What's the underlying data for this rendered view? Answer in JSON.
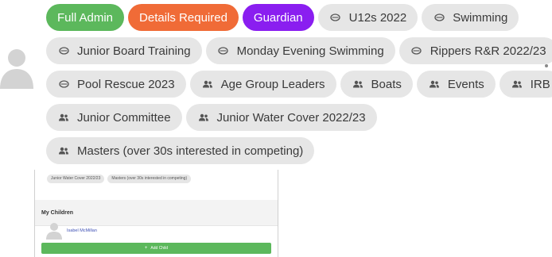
{
  "profile": {
    "avatar_icon": "user-silhouette-icon",
    "menu_icon": "kebab-menu-icon"
  },
  "tags": [
    {
      "label": "Full Admin",
      "style": "green",
      "icon": ""
    },
    {
      "label": "Details Required",
      "style": "orange",
      "icon": ""
    },
    {
      "label": "Guardian",
      "style": "purple",
      "icon": ""
    },
    {
      "label": "U12s 2022",
      "style": "grey",
      "icon": "chat-bubble-icon"
    },
    {
      "label": "Swimming",
      "style": "grey",
      "icon": "chat-bubble-icon"
    },
    {
      "label": "Junior Board Training",
      "style": "grey",
      "icon": "chat-bubble-icon"
    },
    {
      "label": "Monday Evening Swimming",
      "style": "grey",
      "icon": "chat-bubble-icon"
    },
    {
      "label": "Rippers R&R 2022/23",
      "style": "grey",
      "icon": "chat-bubble-icon"
    },
    {
      "label": "Pool Rescue 2023",
      "style": "grey",
      "icon": "chat-bubble-icon"
    },
    {
      "label": "Age Group Leaders",
      "style": "grey",
      "icon": "group-icon"
    },
    {
      "label": "Boats",
      "style": "grey",
      "icon": "group-icon"
    },
    {
      "label": "Events",
      "style": "grey",
      "icon": "group-icon"
    },
    {
      "label": "IRB",
      "style": "grey",
      "icon": "group-icon"
    },
    {
      "label": "Junior Committee",
      "style": "grey",
      "icon": "group-icon"
    },
    {
      "label": "Junior Water Cover 2022/23",
      "style": "grey",
      "icon": "group-icon"
    },
    {
      "label": "Masters (over 30s interested in competing)",
      "style": "grey",
      "icon": "group-icon"
    }
  ],
  "colors": {
    "green": "#5cb85c",
    "orange": "#f06b37",
    "purple": "#8a1ef0",
    "chip_grey": "#e6e6e6",
    "link_blue": "#3f51b5"
  },
  "mini": {
    "tags": [
      "Junior Water Cover 2022/23",
      "Masters (over 30s interested in competing)"
    ],
    "section_title": "My Children",
    "child_name": "Isabel McMillan",
    "add_child_label": "Add Child"
  }
}
